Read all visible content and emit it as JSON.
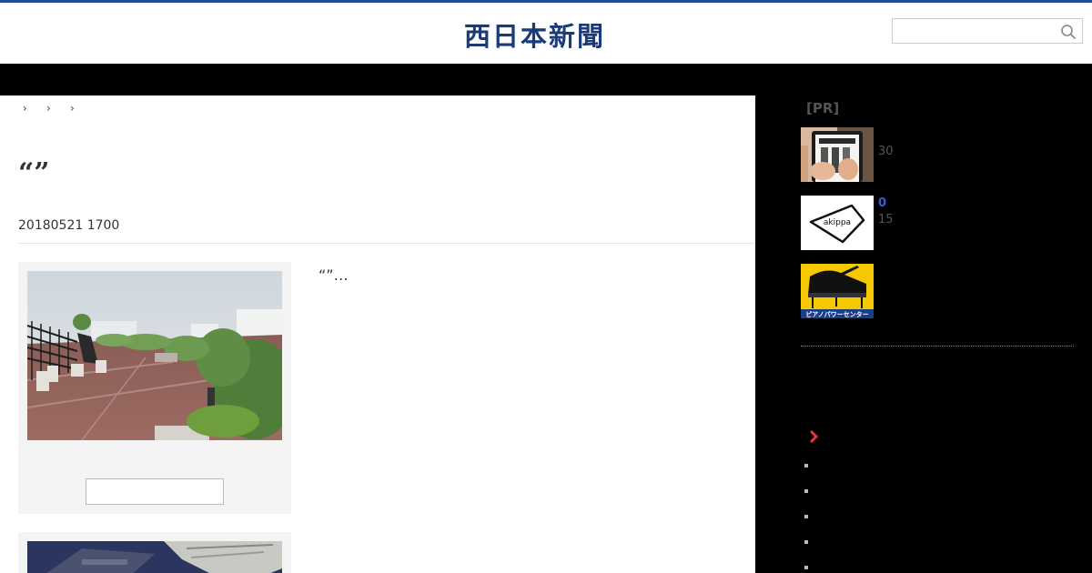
{
  "header": {
    "logo_text": "西日本新聞",
    "search_placeholder": "",
    "search_icon": "search-icon",
    "accent_color": "#1f4e8c"
  },
  "breadcrumb": {
    "items": [
      "",
      "",
      ""
    ],
    "separator_icon": "chevron-right-icon"
  },
  "article": {
    "headline": "“”",
    "date": "20180521 1700",
    "lead": "“”…",
    "figures": [
      {
        "photo": "rooftop-garden-photo",
        "caption": ""
      },
      {
        "photo": "building-aerial-photo",
        "caption": ""
      }
    ]
  },
  "sidebar": {
    "pr_label": "[PR]",
    "ads": [
      {
        "image": "book-ad-image",
        "meta": "30"
      },
      {
        "image": "akippa-logo",
        "logo_text": "akippa",
        "count": "0",
        "meta": "15"
      },
      {
        "image": "piano-ad-image",
        "banner_text": "ピアノパワーセンター"
      }
    ],
    "more_icon": "chevron-right-icon",
    "list_items": [
      "",
      "",
      "",
      "",
      ""
    ],
    "more_color": "#e8343c"
  }
}
